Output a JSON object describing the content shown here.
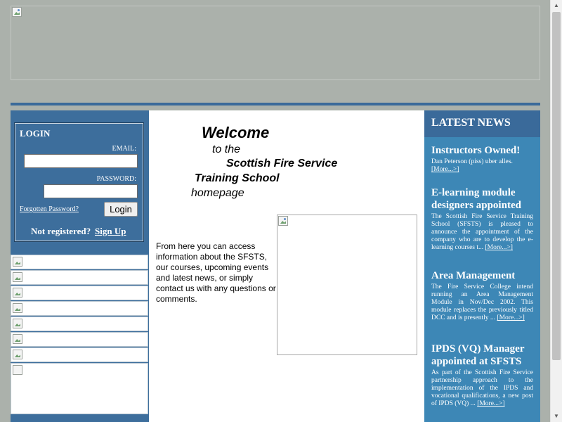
{
  "login": {
    "title": "LOGIN",
    "email_label": "EMAIL:",
    "email_value": "",
    "password_label": "PASSWORD:",
    "password_value": "",
    "forgot_label": "Forgotten Password?",
    "login_button": "Login",
    "not_registered": "Not registered?",
    "signup_label": "Sign Up"
  },
  "welcome": {
    "line1": "Welcome",
    "line2": "to the",
    "line3": "Scottish Fire Service",
    "line4": "Training School",
    "line5": "homepage"
  },
  "intro_text": "From here you can access information about the SFSTS, our courses, upcoming events and latest news, or simply contact us with any questions or comments.",
  "news": {
    "header": "LATEST NEWS",
    "more_label": "[More...>]",
    "items": [
      {
        "title": "Instructors Owned!",
        "body": "Dan Peterson (piss) uber alles."
      },
      {
        "title": "E-learning module designers appointed",
        "body": "The Scottish Fire Service Training School (SFSTS) is pleased to announce the appointment of the company who are to develop the e-learning courses t..."
      },
      {
        "title": "Area Management",
        "body": "The Fire Service College intend running an Area Management Module in Nov/Dec 2002. This module replaces the previously titled DCC and is presently ..."
      },
      {
        "title": "IPDS (VQ) Manager appointed at SFSTS",
        "body": "As part of the Scottish Fire Service partnership approach to the implementation of the IPDS and vocational qualifications, a new post of IPDS (VQ) ..."
      }
    ]
  },
  "colors": {
    "page_bg": "#abb1ab",
    "sidebar_blue": "#3d6e9c",
    "news_blue": "#3d87b6",
    "header_rule": "#3a6a9a"
  }
}
